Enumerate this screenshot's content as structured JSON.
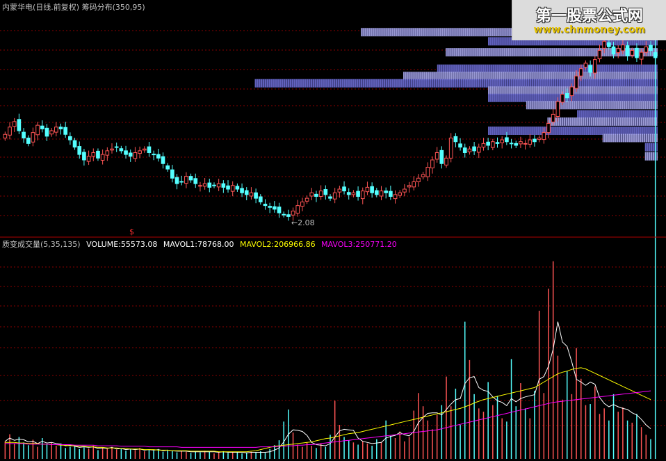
{
  "title": "内蒙华电(日线.前复权) 筹码分布(350,95)",
  "watermark": {
    "title": "第一股票公式网",
    "url": "www.chnmoney.com"
  },
  "price_panel": {
    "low_label": "2.08",
    "signal_mark": "$"
  },
  "indicator": {
    "name": "质变成交量(5,35,135)",
    "volume": "VOLUME:55573.08",
    "mavol1": "MAVOL1:78768.00",
    "mavol2": "MAVOL2:206966.86",
    "mavol3": "MAVOL3:250771.20"
  },
  "colors": {
    "background": "#000000",
    "up": "#ff5555",
    "down": "#54ffff",
    "grid": "#8b0000",
    "divider": "#b00000",
    "chip": "#a7a7e8",
    "chip_dark": "#6b6bd0",
    "mavol1": "#ffffff",
    "mavol2": "#ffff00",
    "mavol3": "#ff00ff",
    "text": "#c0c0c0"
  },
  "chart_data": [
    {
      "type": "candlestick",
      "title": "内蒙华电(日线.前复权) 筹码分布(350,95)",
      "ylim": [
        2.0,
        3.2
      ],
      "low_annotation": 2.08,
      "close": [
        2.54,
        2.58,
        2.61,
        2.56,
        2.52,
        2.49,
        2.55,
        2.59,
        2.57,
        2.53,
        2.56,
        2.58,
        2.57,
        2.54,
        2.51,
        2.47,
        2.43,
        2.4,
        2.42,
        2.44,
        2.41,
        2.43,
        2.45,
        2.46,
        2.47,
        2.45,
        2.43,
        2.42,
        2.44,
        2.45,
        2.46,
        2.44,
        2.43,
        2.41,
        2.38,
        2.35,
        2.3,
        2.27,
        2.28,
        2.31,
        2.29,
        2.27,
        2.26,
        2.27,
        2.25,
        2.26,
        2.27,
        2.25,
        2.24,
        2.26,
        2.24,
        2.22,
        2.21,
        2.22,
        2.19,
        2.17,
        2.15,
        2.14,
        2.13,
        2.11,
        2.1,
        2.09,
        2.12,
        2.15,
        2.17,
        2.19,
        2.22,
        2.2,
        2.23,
        2.21,
        2.19,
        2.22,
        2.24,
        2.23,
        2.21,
        2.22,
        2.2,
        2.23,
        2.25,
        2.22,
        2.21,
        2.23,
        2.22,
        2.2,
        2.21,
        2.22,
        2.24,
        2.26,
        2.28,
        2.3,
        2.32,
        2.36,
        2.4,
        2.44,
        2.38,
        2.41,
        2.52,
        2.5,
        2.47,
        2.44,
        2.46,
        2.45,
        2.47,
        2.49,
        2.48,
        2.5,
        2.49,
        2.51,
        2.5,
        2.49,
        2.48,
        2.5,
        2.49,
        2.51,
        2.5,
        2.52,
        2.55,
        2.6,
        2.65,
        2.72,
        2.76,
        2.74,
        2.8,
        2.86,
        2.9,
        2.93,
        2.88,
        2.95,
        3.0,
        3.05,
        3.02,
        2.98,
        3.01,
        3.03,
        2.97,
        3.0,
        2.96,
        2.99,
        3.02,
        3.0,
        2.96
      ],
      "volume": [
        32,
        45,
        28,
        40,
        30,
        25,
        35,
        22,
        38,
        26,
        30,
        24,
        28,
        20,
        22,
        25,
        18,
        21,
        19,
        24,
        16,
        20,
        18,
        22,
        17,
        19,
        15,
        18,
        16,
        20,
        14,
        17,
        15,
        18,
        13,
        16,
        14,
        12,
        15,
        13,
        11,
        14,
        12,
        15,
        13,
        10,
        12,
        14,
        11,
        13,
        12,
        10,
        11,
        13,
        12,
        14,
        11,
        18,
        25,
        34,
        68,
        90,
        48,
        26,
        22,
        30,
        24,
        20,
        28,
        22,
        44,
        106,
        62,
        40,
        34,
        30,
        26,
        32,
        28,
        24,
        36,
        30,
        70,
        42,
        38,
        50,
        32,
        40,
        88,
        120,
        96,
        70,
        54,
        80,
        98,
        150,
        96,
        128,
        62,
        250,
        180,
        118,
        92,
        86,
        140,
        98,
        115,
        74,
        68,
        182,
        96,
        138,
        92,
        74,
        124,
        270,
        120,
        310,
        360,
        188,
        108,
        160,
        118,
        202,
        146,
        98,
        100,
        132,
        82,
        92,
        70,
        118,
        86,
        94,
        70,
        66,
        82,
        58,
        44,
        36
      ],
      "mavol1": [
        32,
        38,
        34,
        36,
        35,
        31,
        32,
        28,
        32,
        29,
        30,
        28,
        27,
        24,
        25,
        23,
        21,
        22,
        21,
        22,
        19,
        20,
        19,
        21,
        18,
        19,
        17,
        18,
        17,
        18,
        16,
        17,
        16,
        17,
        15,
        16,
        15,
        14,
        14,
        14,
        13,
        13,
        13,
        13,
        13,
        13,
        12,
        13,
        12,
        12,
        12,
        12,
        11,
        12,
        12,
        12,
        12,
        13,
        16,
        20,
        31,
        45,
        53,
        52,
        50,
        43,
        30,
        26,
        25,
        24,
        28,
        40,
        51,
        54,
        53,
        52,
        38,
        32,
        30,
        28,
        29,
        30,
        38,
        41,
        43,
        48,
        44,
        42,
        50,
        66,
        76,
        83,
        84,
        84,
        80,
        90,
        100,
        108,
        110,
        137,
        148,
        150,
        130,
        125,
        123,
        113,
        106,
        103,
        97,
        110,
        104,
        110,
        113,
        115,
        117,
        145,
        150,
        169,
        200,
        250,
        213,
        205,
        177,
        145,
        140,
        134,
        140,
        136,
        112,
        101,
        95,
        99,
        95,
        92,
        90,
        84,
        80,
        72,
        62,
        55
      ],
      "mavol2": [
        30,
        30,
        30,
        29,
        29,
        28,
        28,
        28,
        27,
        27,
        26,
        26,
        25,
        25,
        24,
        24,
        23,
        23,
        22,
        22,
        21,
        21,
        20,
        20,
        20,
        19,
        19,
        18,
        18,
        18,
        17,
        17,
        17,
        16,
        16,
        16,
        15,
        15,
        15,
        15,
        14,
        14,
        14,
        14,
        14,
        14,
        13,
        13,
        13,
        13,
        13,
        13,
        13,
        14,
        15,
        17,
        19,
        21,
        23,
        24,
        25,
        26,
        27,
        28,
        29,
        30,
        31,
        33,
        35,
        37,
        38,
        40,
        42,
        44,
        46,
        47,
        48,
        50,
        52,
        54,
        56,
        58,
        60,
        62,
        64,
        66,
        68,
        70,
        72,
        74,
        76,
        78,
        80,
        82,
        84,
        86,
        88,
        90,
        92,
        95,
        98,
        102,
        105,
        108,
        110,
        112,
        114,
        116,
        118,
        120,
        122,
        124,
        126,
        128,
        130,
        135,
        140,
        145,
        150,
        155,
        158,
        160,
        163,
        165,
        166,
        164,
        160,
        156,
        152,
        148,
        144,
        140,
        136,
        132,
        128,
        124,
        120,
        116,
        112,
        108
      ],
      "mavol3": [
        28,
        28,
        28,
        28,
        28,
        27,
        27,
        27,
        27,
        27,
        26,
        26,
        26,
        26,
        26,
        25,
        25,
        25,
        25,
        25,
        24,
        24,
        24,
        24,
        24,
        23,
        23,
        23,
        23,
        23,
        23,
        22,
        22,
        22,
        22,
        22,
        22,
        22,
        21,
        21,
        21,
        21,
        21,
        21,
        21,
        21,
        21,
        21,
        21,
        21,
        21,
        21,
        21,
        21,
        21,
        22,
        22,
        22,
        22,
        23,
        23,
        24,
        24,
        25,
        25,
        26,
        26,
        27,
        28,
        29,
        30,
        31,
        32,
        33,
        34,
        35,
        36,
        37,
        38,
        39,
        40,
        41,
        42,
        43,
        44,
        45,
        46,
        47,
        48,
        49,
        50,
        51,
        52,
        53,
        55,
        57,
        59,
        61,
        63,
        65,
        67,
        69,
        71,
        73,
        75,
        77,
        79,
        81,
        83,
        85,
        87,
        89,
        91,
        93,
        95,
        97,
        99,
        101,
        103,
        104,
        105,
        106,
        107,
        108,
        109,
        110,
        111,
        112,
        113,
        114,
        115,
        116,
        117,
        118,
        119,
        120,
        121,
        122,
        123,
        124
      ],
      "chip_distribution": [
        {
          "price": 3.1,
          "amount": 0.7
        },
        {
          "price": 3.05,
          "amount": 0.4
        },
        {
          "price": 2.99,
          "amount": 0.5
        },
        {
          "price": 2.9,
          "amount": 0.52
        },
        {
          "price": 2.86,
          "amount": 0.6
        },
        {
          "price": 2.82,
          "amount": 0.95
        },
        {
          "price": 2.78,
          "amount": 0.4
        },
        {
          "price": 2.74,
          "amount": 0.4
        },
        {
          "price": 2.7,
          "amount": 0.31
        },
        {
          "price": 2.65,
          "amount": 0.19
        },
        {
          "price": 2.61,
          "amount": 0.26
        },
        {
          "price": 2.56,
          "amount": 0.4
        },
        {
          "price": 2.52,
          "amount": 0.13
        },
        {
          "price": 2.47,
          "amount": 0.03
        },
        {
          "price": 2.42,
          "amount": 0.03
        }
      ]
    }
  ]
}
